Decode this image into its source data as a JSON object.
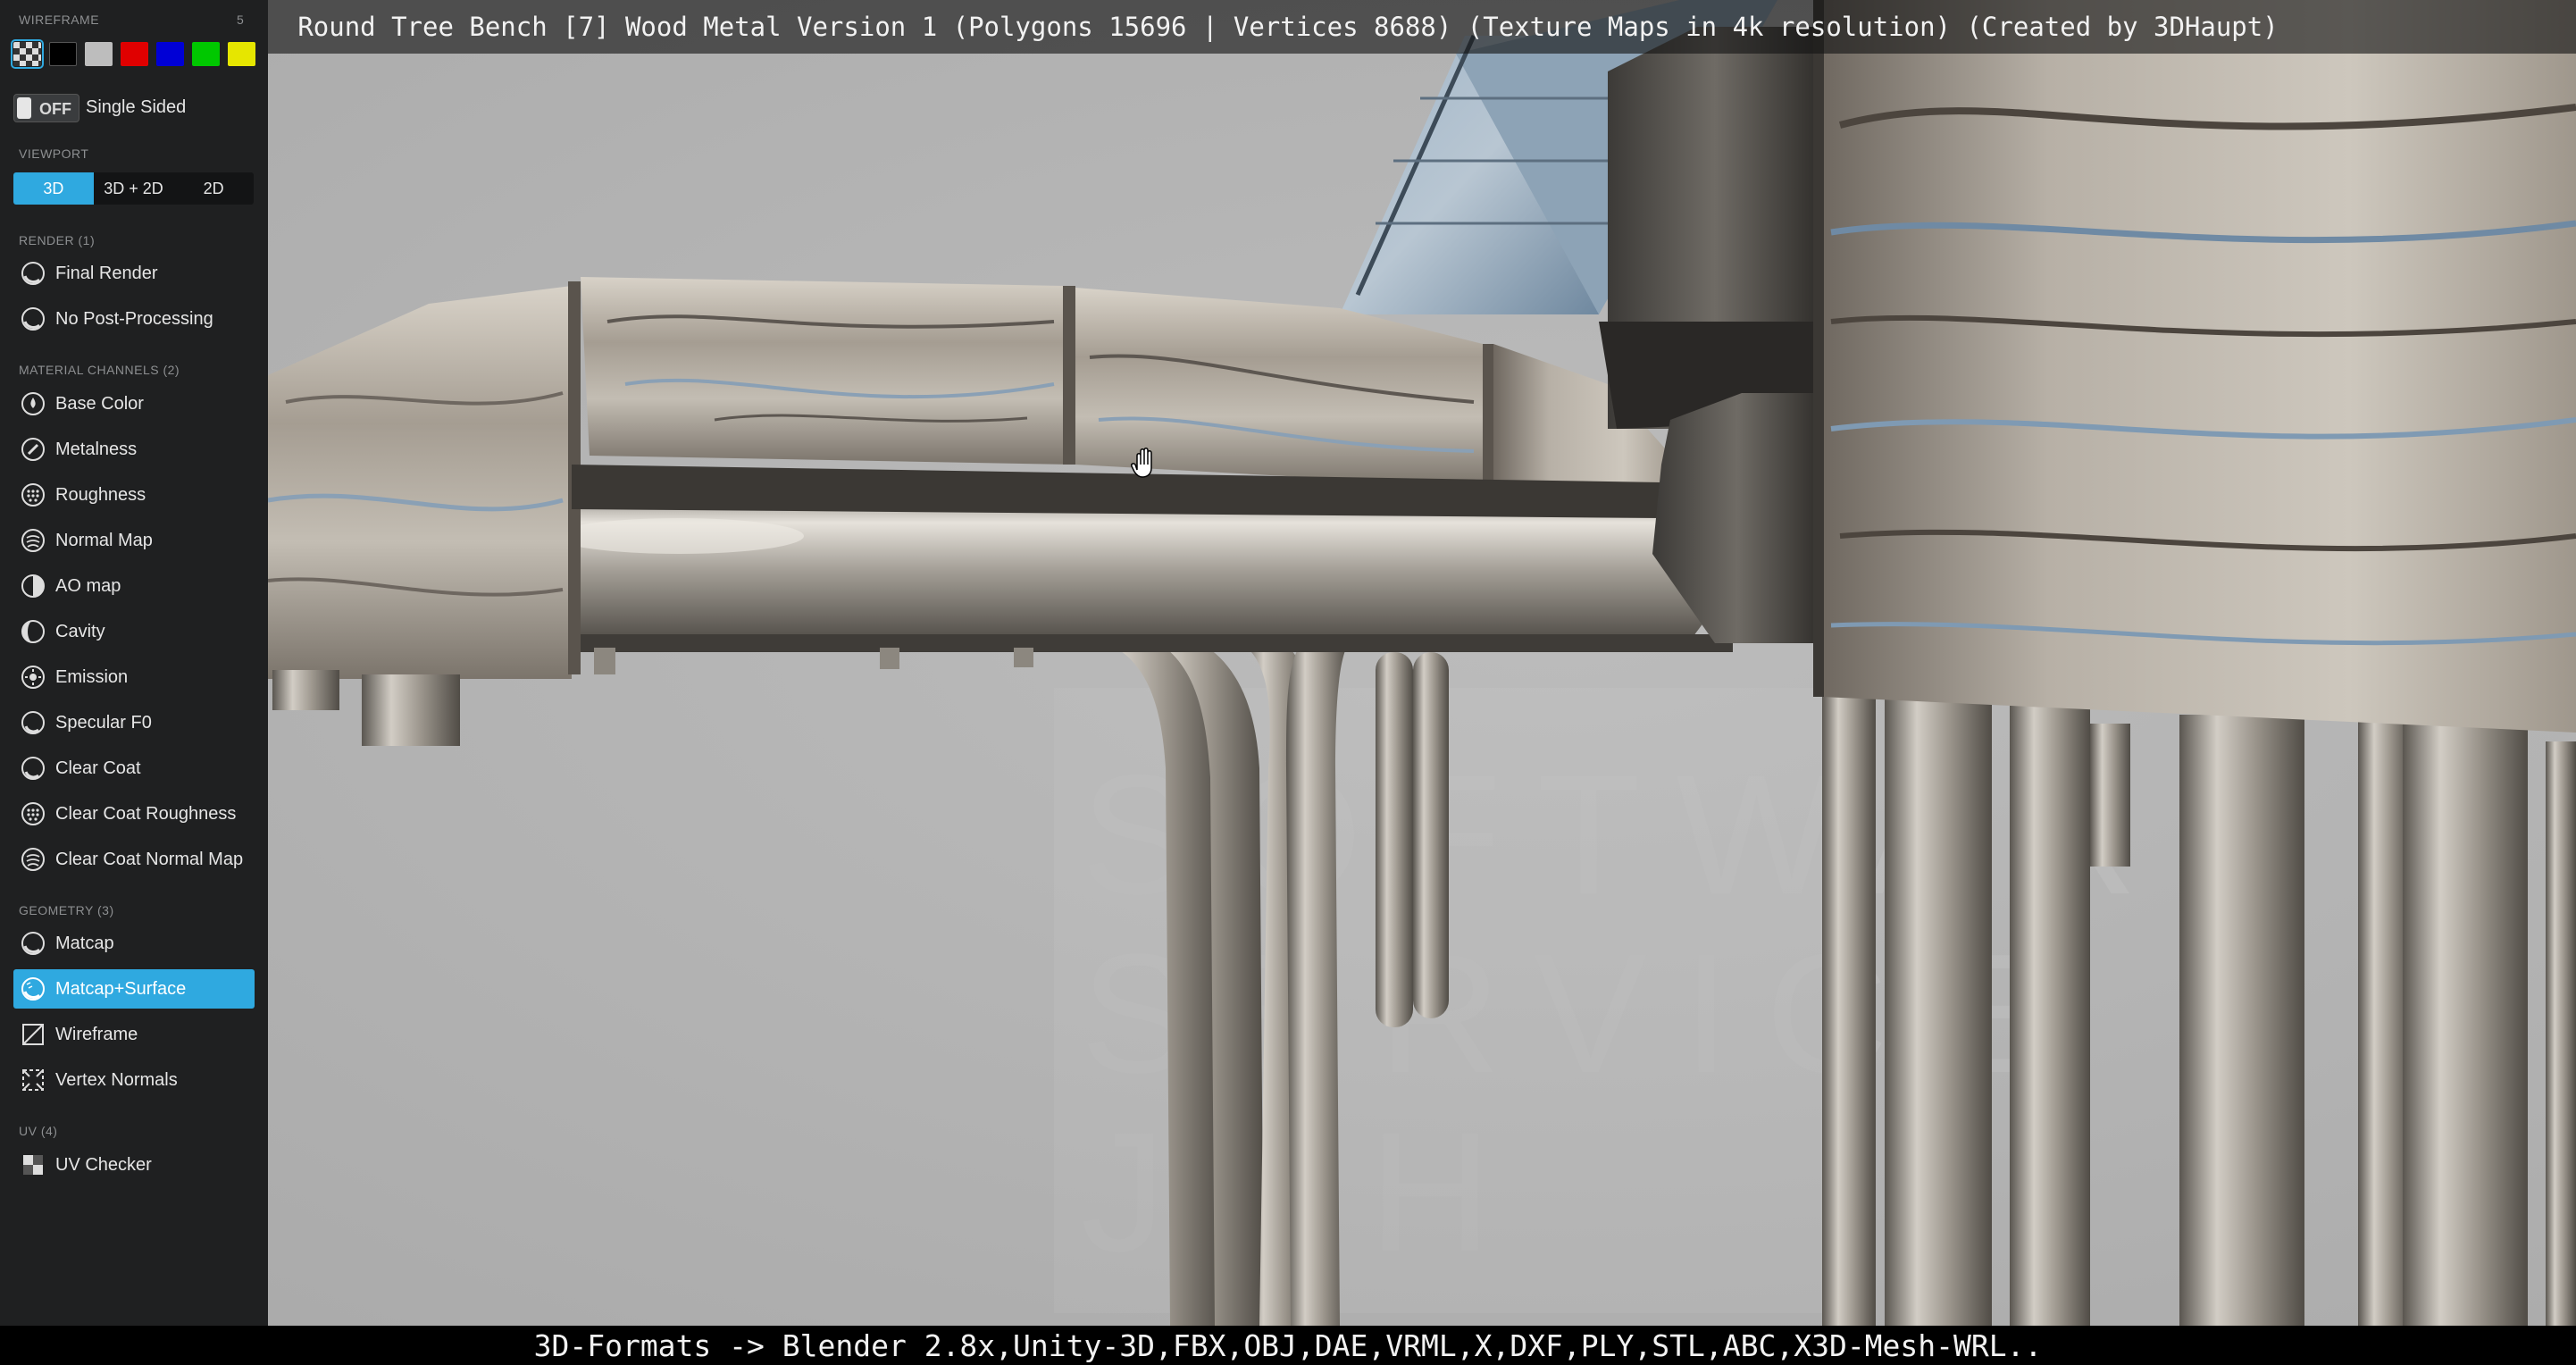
{
  "title": "Round Tree Bench [7] Wood Metal Version 1 (Polygons 15696 | Vertices 8688) (Texture Maps in 4k resolution) (Created by 3DHaupt)",
  "footer": "3D-Formats -> Blender 2.8x,Unity-3D,FBX,OBJ,DAE,VRML,X,DXF,PLY,STL,ABC,X3D-Mesh-WRL..",
  "panel": {
    "wireframe_section": "WIREFRAME",
    "wireframe_count": "5",
    "swatches": [
      {
        "name": "checker",
        "color": "#9a9a9a"
      },
      {
        "name": "black",
        "color": "#000000"
      },
      {
        "name": "gray",
        "color": "#bdbdbd"
      },
      {
        "name": "red",
        "color": "#e00000"
      },
      {
        "name": "blue",
        "color": "#0000d6"
      },
      {
        "name": "green",
        "color": "#00c800"
      },
      {
        "name": "yellow",
        "color": "#e6e600"
      }
    ],
    "single_sided": {
      "state": "OFF",
      "label": "Single Sided"
    },
    "viewport_section": "VIEWPORT",
    "viewport_tabs": [
      "3D",
      "3D + 2D",
      "2D"
    ],
    "viewport_selected": "3D",
    "render_section": "RENDER (1)",
    "render_items": [
      {
        "label": "Final Render",
        "icon": "sphere-icon"
      },
      {
        "label": "No Post-Processing",
        "icon": "sphere-icon"
      }
    ],
    "material_section": "MATERIAL CHANNELS (2)",
    "material_items": [
      {
        "label": "Base Color",
        "icon": "base-color-icon"
      },
      {
        "label": "Metalness",
        "icon": "metalness-icon"
      },
      {
        "label": "Roughness",
        "icon": "roughness-icon"
      },
      {
        "label": "Normal Map",
        "icon": "normal-map-icon"
      },
      {
        "label": "AO map",
        "icon": "ao-map-icon"
      },
      {
        "label": "Cavity",
        "icon": "cavity-icon"
      },
      {
        "label": "Emission",
        "icon": "emission-icon"
      },
      {
        "label": "Specular F0",
        "icon": "specular-icon"
      },
      {
        "label": "Clear Coat",
        "icon": "clear-coat-icon"
      },
      {
        "label": "Clear Coat Roughness",
        "icon": "clear-coat-roughness-icon"
      },
      {
        "label": "Clear Coat Normal Map",
        "icon": "clear-coat-normal-icon"
      }
    ],
    "geometry_section": "GEOMETRY (3)",
    "geometry_items": [
      {
        "label": "Matcap",
        "icon": "matcap-icon"
      },
      {
        "label": "Matcap+Surface",
        "icon": "matcap-surface-icon",
        "active": true
      },
      {
        "label": "Wireframe",
        "icon": "wireframe-icon"
      },
      {
        "label": "Vertex Normals",
        "icon": "vertex-normals-icon"
      }
    ],
    "uv_section": "UV (4)",
    "uv_items": [
      {
        "label": "UV Checker",
        "icon": "uv-checker-icon"
      }
    ]
  },
  "viewport": {
    "watermark_lines": [
      "SOFTWARE",
      "SERVICE",
      "JOH"
    ]
  },
  "colors": {
    "accent": "#2fa9e0",
    "panel_bg": "#1f2021",
    "viewport_bg": "#b6b6b6"
  }
}
